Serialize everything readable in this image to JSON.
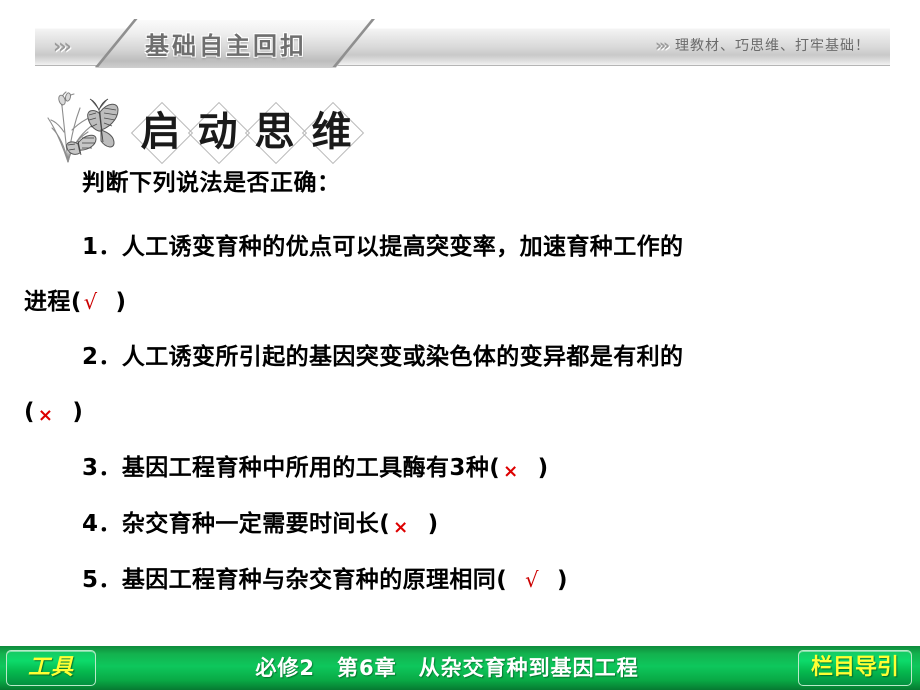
{
  "banner": {
    "section_title": "基础自主回扣",
    "tagline": "理教材、巧思维、打牢基础！",
    "chevron_left": "》》",
    "chevron_right": "》》",
    "colors": {
      "bar_light": "#f4f4f4",
      "bar_dark": "#c9c9c9",
      "title_text": "#6e6e6e"
    }
  },
  "heading": {
    "chars": [
      "启",
      "动",
      "思",
      "维"
    ],
    "full_text": "启动思维",
    "illustration_alt": "butterfly-grass-illustration"
  },
  "content": {
    "prompt": "判断下列说法是否正确：",
    "items": [
      {
        "number": "1．",
        "line1": "人工诱变育种的优点可以提高突变率，加速育种工作的",
        "line2": "进程",
        "answer": "tick",
        "answer_glyph": "√",
        "wrapped": true
      },
      {
        "number": "2．",
        "line1": "人工诱变所引起的基因突变或染色体的变异都是有利的",
        "line2": "",
        "answer": "cross",
        "answer_glyph": "×",
        "wrapped": true
      },
      {
        "number": "3．",
        "line1": "基因工程育种中所用的工具酶有3种",
        "answer": "cross",
        "answer_glyph": "×",
        "wrapped": false
      },
      {
        "number": "4．",
        "line1": "杂交育种一定需要时间长",
        "answer": "cross",
        "answer_glyph": "×",
        "wrapped": false
      },
      {
        "number": "5．",
        "line1": "基因工程育种与杂交育种的原理相同",
        "answer": "tick",
        "answer_glyph": "√",
        "wrapped": false
      }
    ],
    "paren_open": "(",
    "paren_close": ")",
    "answer_colors": {
      "tick": "#cc0000",
      "cross": "#dd0000"
    }
  },
  "footer": {
    "tool_label": "工具",
    "center_label": "必修2　第6章　从杂交育种到基因工程",
    "nav_label": "栏目导引",
    "colors": {
      "bar": "#0ec75c",
      "label_text": "#ffff33",
      "center_text": "#ffffff"
    }
  }
}
